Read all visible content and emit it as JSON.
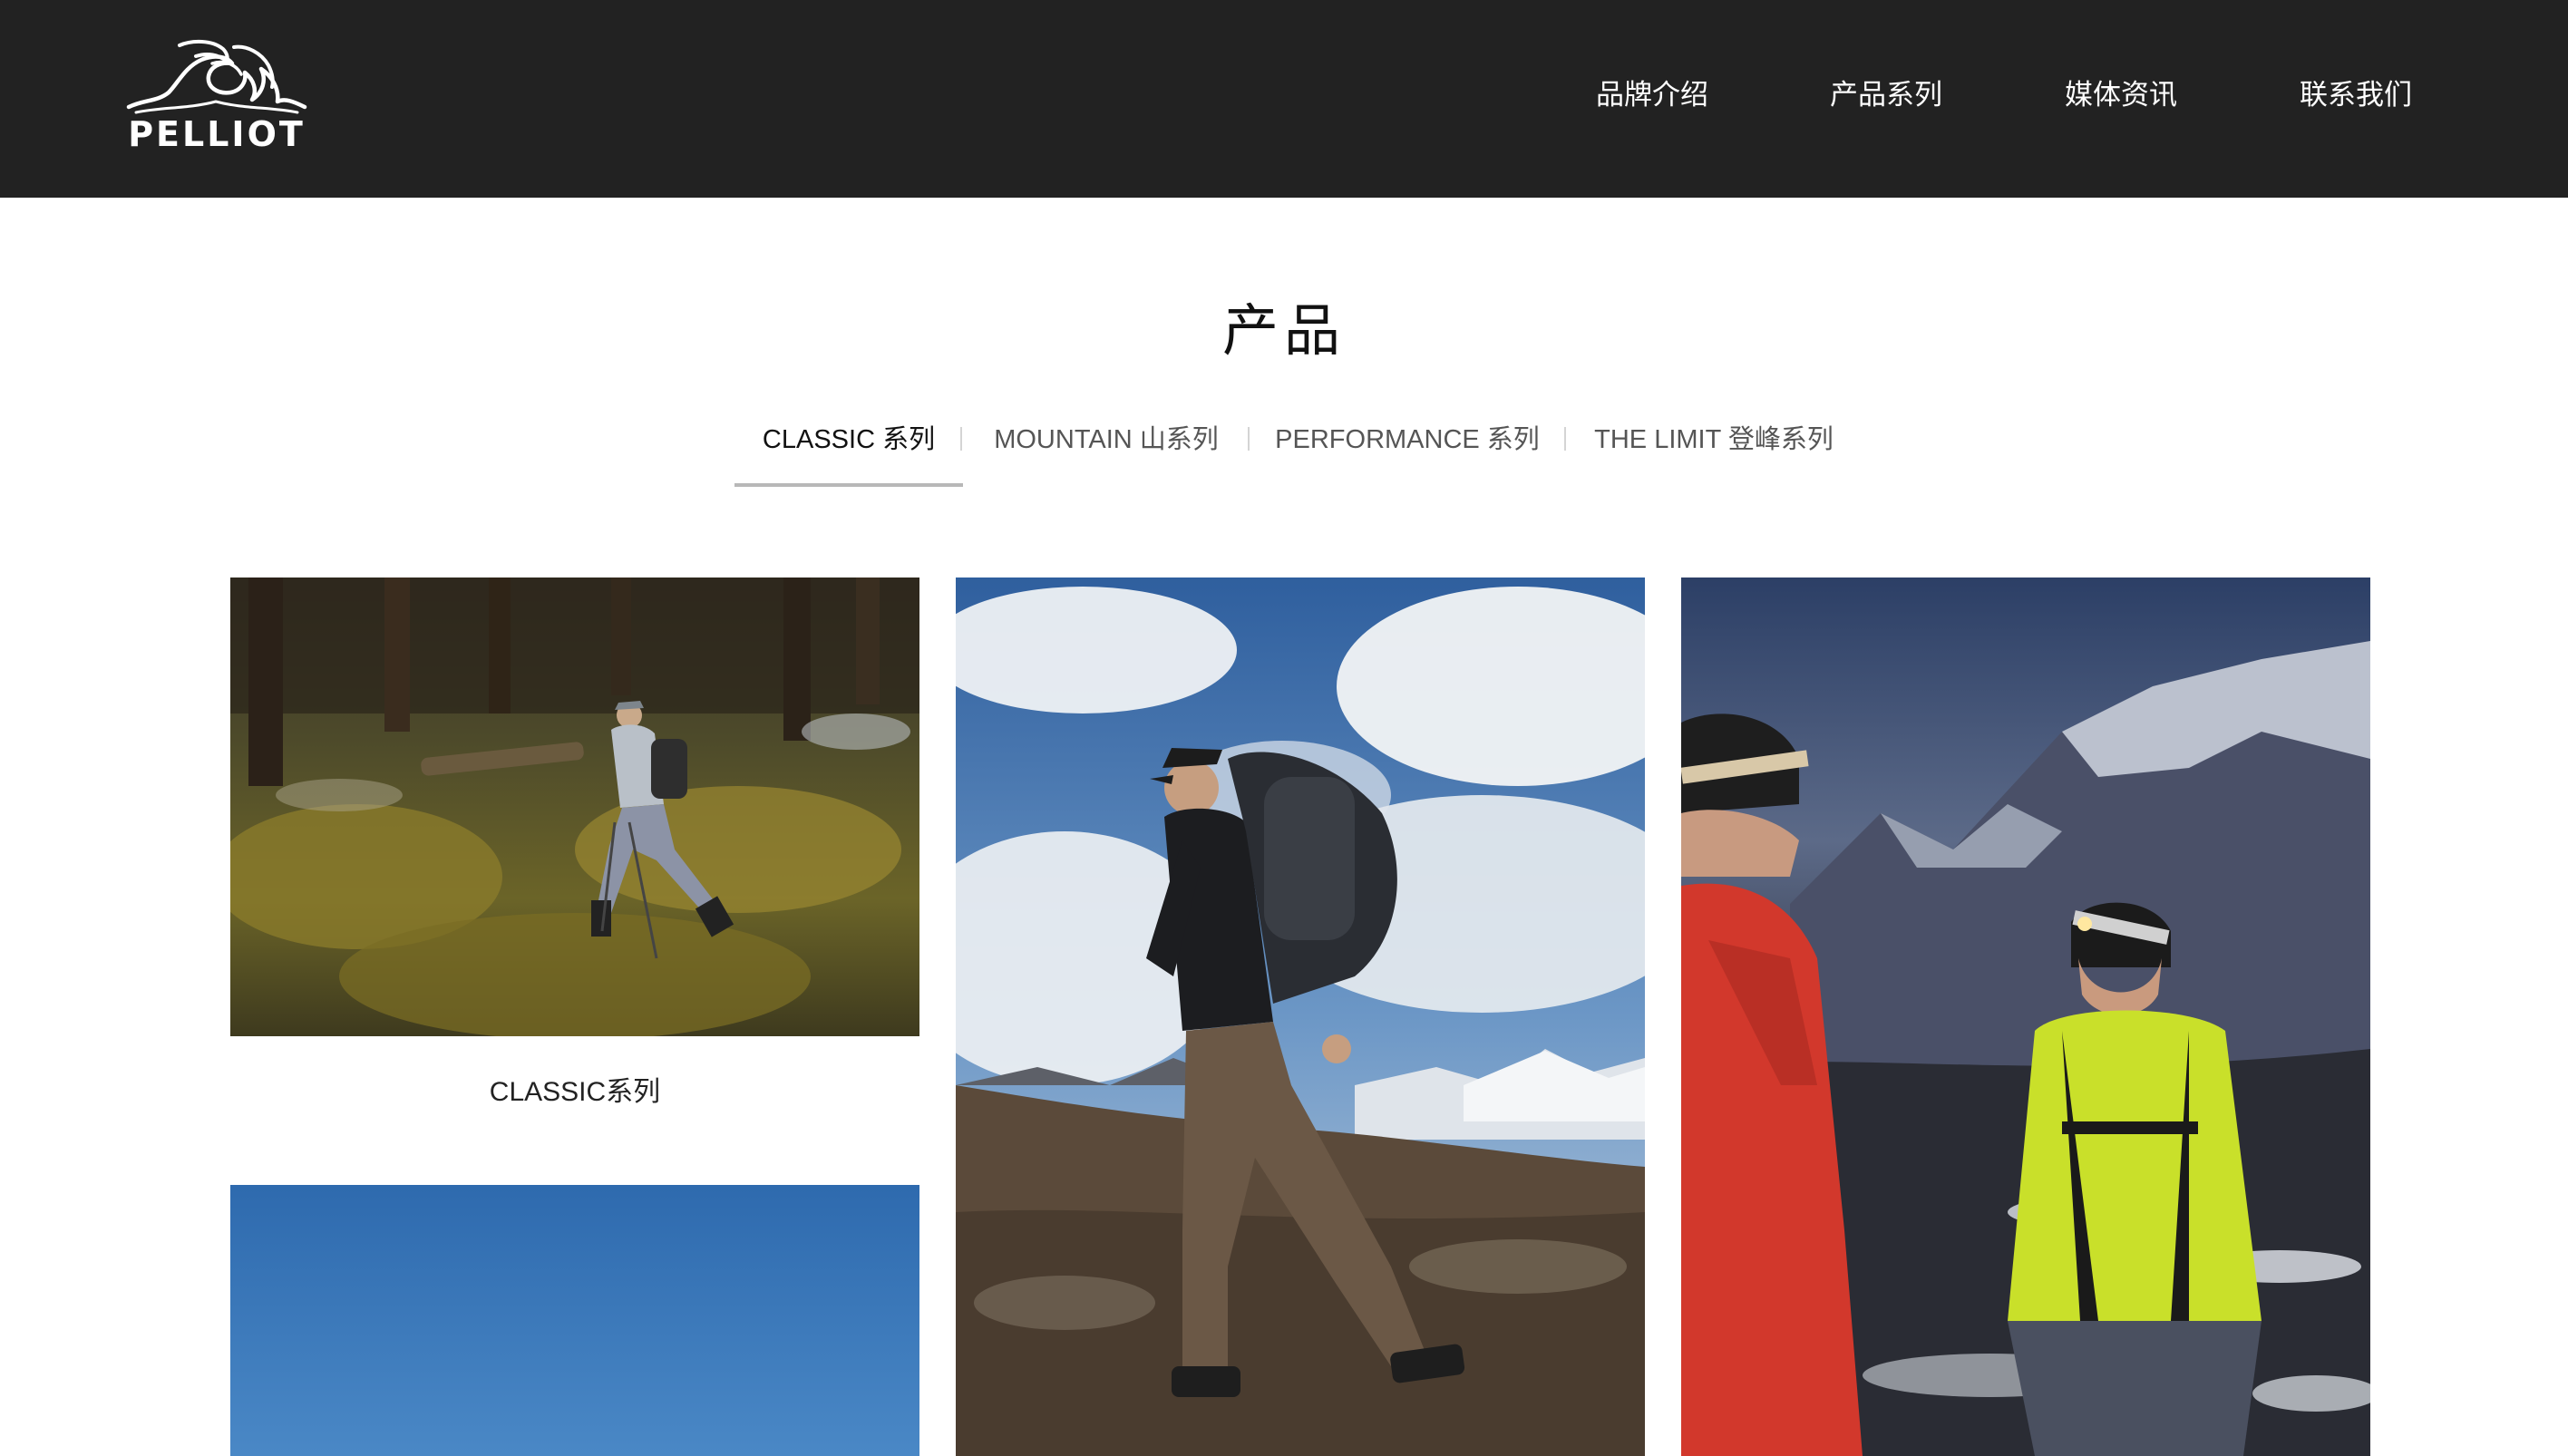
{
  "header": {
    "logo_text": "PELLIOT",
    "nav": [
      {
        "label": "品牌介绍"
      },
      {
        "label": "产品系列"
      },
      {
        "label": "媒体资讯"
      },
      {
        "label": "联系我们"
      }
    ]
  },
  "main": {
    "title": "产品",
    "tabs": [
      {
        "label": "CLASSIC 系列",
        "active": true
      },
      {
        "label": "MOUNTAIN 山系列",
        "active": false
      },
      {
        "label": "PERFORMANCE 系列",
        "active": false
      },
      {
        "label": "THE LIMIT 登峰系列",
        "active": false
      }
    ],
    "products": [
      {
        "caption": "CLASSIC系列",
        "image": "hiker-in-forest"
      },
      {
        "caption": "",
        "image": "hiker-with-backpack-clouds"
      },
      {
        "caption": "",
        "image": "climbers-with-headlamps-snowy-mountains"
      },
      {
        "caption": "",
        "image": "blue-sky"
      }
    ]
  },
  "colors": {
    "header_bg": "#222222",
    "text_dark": "#111111",
    "tab_inactive": "#555555",
    "tab_underline": "#b8b8b8"
  }
}
